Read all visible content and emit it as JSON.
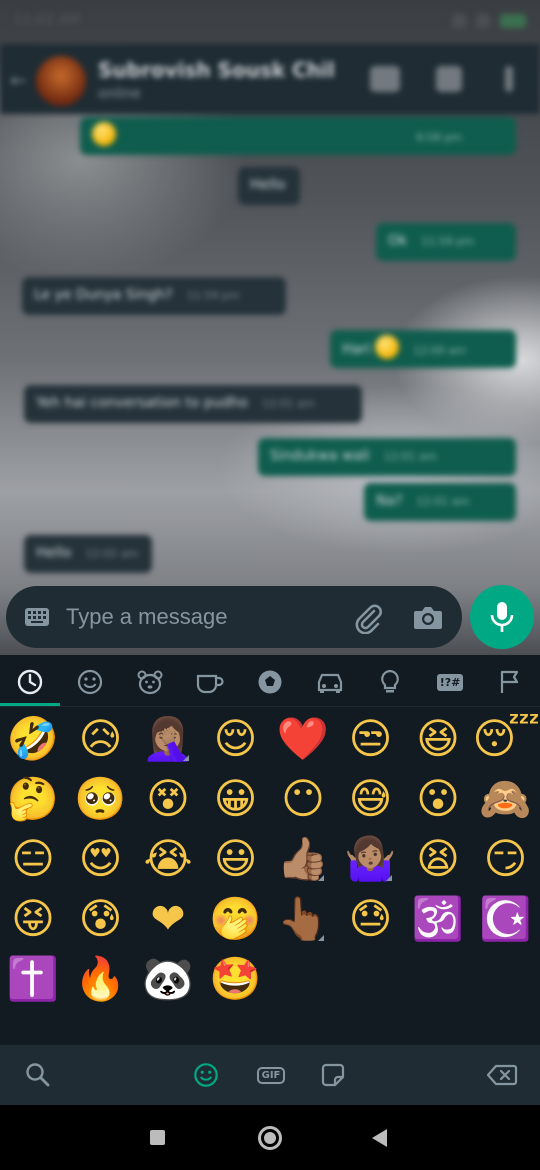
{
  "status_bar": {
    "time": "11:02 AM"
  },
  "header": {
    "name": "Subrovish Sousk Chil",
    "status": "online"
  },
  "messages": [
    {
      "text": "",
      "time": "9:58 pm",
      "dir": "out",
      "emoji": true
    },
    {
      "text": "Hello",
      "time": "",
      "dir": "in",
      "emoji": false
    },
    {
      "text": "Ok",
      "time": "11:59 pm",
      "dir": "out",
      "emoji": false
    },
    {
      "text": "Le ye Dunya Singh?",
      "time": "11:59 pm",
      "dir": "in",
      "emoji": false
    },
    {
      "text": "Hari",
      "time": "12:00 am",
      "dir": "out",
      "emoji": true
    },
    {
      "text": "Yeh hai conversation to pudho",
      "time": "12:01 am",
      "dir": "in",
      "emoji": false
    },
    {
      "text": "Sindukwa wali",
      "time": "12:01 am",
      "dir": "out",
      "emoji": false
    },
    {
      "text": "Na?",
      "time": "12:01 am",
      "dir": "out",
      "emoji": false
    },
    {
      "text": "Hello",
      "time": "12:02 am",
      "dir": "in",
      "emoji": false
    }
  ],
  "input": {
    "placeholder": "Type a message"
  },
  "emoji_tabs": [
    "recent",
    "smileys",
    "animals",
    "food",
    "activity",
    "travel",
    "objects",
    "symbols",
    "flags"
  ],
  "emoji_tab_symbols_label": "!?#",
  "emojis": [
    "🤣",
    "😥",
    "🤦🏽‍♀️",
    "😌",
    "❤️",
    "😒",
    "😆",
    "😴",
    "🤔",
    "🥺",
    "😵",
    "😀",
    "😶",
    "😅",
    "😮",
    "🙈",
    "😑",
    "😍",
    "😭",
    "😃",
    "👍🏽",
    "🤷🏽‍♀️",
    "😫",
    "😏",
    "😝",
    "😰",
    "❤",
    "🤭",
    "👆🏾",
    "😓",
    "🕉️",
    "☪️",
    "✝️",
    "🔥",
    "🐼",
    "🤩"
  ],
  "emoji_with_skin_menu": [
    2,
    20,
    21,
    28
  ],
  "panel_bottom": {
    "gif_label": "GIF"
  },
  "colors": {
    "accent": "#00a884",
    "panel": "#121b22",
    "header": "#1f2c34"
  }
}
